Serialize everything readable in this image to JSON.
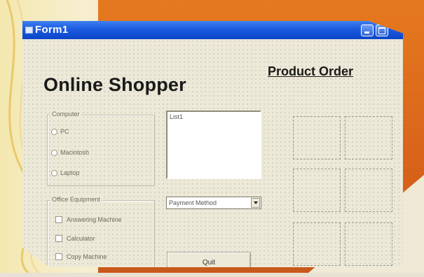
{
  "window": {
    "title": "Form1"
  },
  "form": {
    "page_title": "Online Shopper",
    "product_order_label": "Product Order"
  },
  "computer_frame": {
    "caption": "Computer",
    "options": [
      "PC",
      "Macintosh",
      "Laptop"
    ]
  },
  "office_frame": {
    "caption": "Office Equipment",
    "options": [
      "Answering Machine",
      "Calculator",
      "Copy Machine"
    ]
  },
  "listbox": {
    "items": [
      "List1"
    ]
  },
  "payment_combo": {
    "selected": "Payment Method"
  },
  "quit_button": {
    "label": "Quit"
  },
  "image_slots": 6,
  "colors": {
    "titlebar": "#1b5ae0",
    "window_bg": "#ece9d8",
    "backdrop_orange": "#e5791f"
  }
}
